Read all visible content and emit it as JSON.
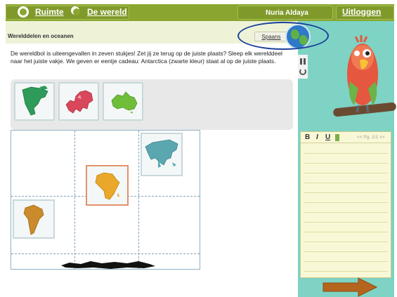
{
  "topbar": {
    "nav": [
      {
        "label": "Ruimte",
        "icon": "globe-icon"
      },
      {
        "label": "De wereld",
        "icon": "globe-icon"
      }
    ],
    "user_name": "Nuria Aldaya",
    "logout_label": "Uitloggen"
  },
  "header": {
    "title": "Werelddelen en oceanen",
    "language_button": "Spaans"
  },
  "instructions": "De wereldbol is uiteengevallen in zeven stukjes! Zet jij ze terug op de juiste plaats? Sleep elk werelddeel naar het juiste vakje. We geven er eentje cadeau: Antarctica (zwarte kleur) staat al op de juiste plaats.",
  "tray": {
    "pieces": [
      {
        "continent": "Noord-Amerika",
        "color": "#2e9b5a"
      },
      {
        "continent": "Europa",
        "color": "#d9475a"
      },
      {
        "continent": "Australië",
        "color": "#6fbe3a"
      }
    ]
  },
  "grid": {
    "placed": [
      {
        "continent": "Azië",
        "color": "#5aa7b0"
      },
      {
        "continent": "Afrika",
        "color": "#e9a82a"
      },
      {
        "continent": "Zuid-Amerika",
        "color": "#c98b2c"
      },
      {
        "continent": "Antarctica",
        "color": "#111111"
      }
    ]
  },
  "notepad": {
    "bold": "B",
    "italic": "I",
    "underline": "U",
    "page_info": "<< Pg. 1/1 >>"
  },
  "colors": {
    "topbar": "#8aa630",
    "panel": "#7ed3c4",
    "accent_arrow": "#b5641e",
    "highlight": "#1a3f9a"
  }
}
